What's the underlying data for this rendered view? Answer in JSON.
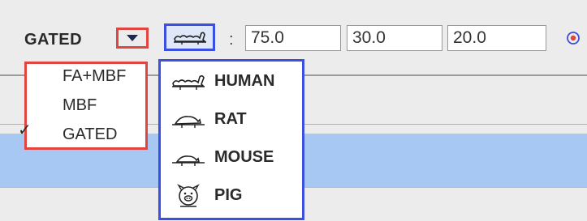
{
  "toolbar": {
    "mode_value": "GATED",
    "colon": ":",
    "fields": [
      "75.0",
      "30.0",
      "20.0"
    ],
    "icons": {
      "mode_dropdown": "triangle-down-icon",
      "species": "human-body-icon",
      "target": "target-icon"
    }
  },
  "mode_menu": {
    "items": [
      {
        "label": "FA+MBF",
        "checked": false
      },
      {
        "label": "MBF",
        "checked": false
      },
      {
        "label": "GATED",
        "checked": true
      }
    ],
    "check_mark": "✓"
  },
  "species_menu": {
    "items": [
      {
        "label": "HUMAN",
        "icon": "human-body-icon"
      },
      {
        "label": "RAT",
        "icon": "rat-icon"
      },
      {
        "label": "MOUSE",
        "icon": "mouse-icon"
      },
      {
        "label": "PIG",
        "icon": "pig-icon"
      }
    ]
  },
  "colors": {
    "mode_highlight": "#e0453f",
    "species_highlight": "#3b4fe0",
    "selection_band": "#a7c8f2"
  }
}
